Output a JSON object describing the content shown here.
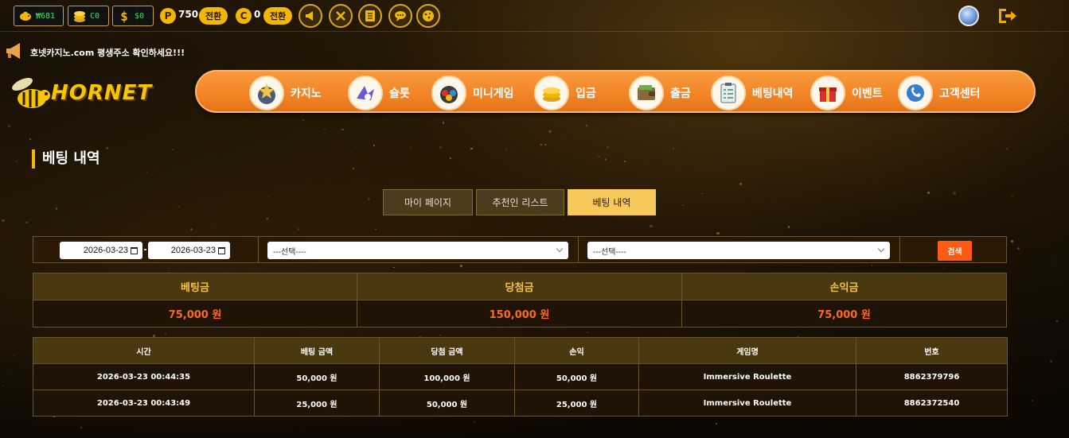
{
  "topbar": {
    "wallets": [
      {
        "icon": "piggy-bank-icon",
        "value": "₩681"
      },
      {
        "icon": "coin-stack-icon",
        "value": "C0"
      },
      {
        "icon": "dollar-icon",
        "value": "$0"
      }
    ],
    "point": {
      "badge": "P",
      "value": "750",
      "swap_label": "전환"
    },
    "coin": {
      "badge": "C",
      "value": "0",
      "swap_label": "전환"
    },
    "icons": [
      "megaphone-icon",
      "tools-icon",
      "notepad-icon",
      "chat-icon",
      "cookie-icon"
    ]
  },
  "notice": {
    "text": "호넷카지노.com 평생주소 확인하세요!!!"
  },
  "logo": {
    "text": "HORNET"
  },
  "nav": [
    {
      "label": "카지노",
      "icon": "casino-chip-icon"
    },
    {
      "label": "슬롯",
      "icon": "slot-icon"
    },
    {
      "label": "미니게임",
      "icon": "minigame-icon"
    },
    {
      "label": "입금",
      "icon": "deposit-coins-icon"
    },
    {
      "label": "출금",
      "icon": "wallet-icon"
    },
    {
      "label": "베팅내역",
      "icon": "clipboard-icon"
    },
    {
      "label": "이벤트",
      "icon": "gift-icon"
    },
    {
      "label": "고객센터",
      "icon": "support-chat-icon"
    }
  ],
  "page": {
    "title": "베팅 내역"
  },
  "tabs": [
    {
      "label": "마이 페이지",
      "active": false
    },
    {
      "label": "추천인 리스트",
      "active": false
    },
    {
      "label": "베팅 내역",
      "active": true
    }
  ],
  "filter": {
    "date_from": "2026-03-23",
    "date_to": "2026-03-23",
    "select1": "---선택----",
    "select2": "---선택----",
    "search_label": "검색"
  },
  "summary": [
    {
      "label": "베팅금",
      "value": "75,000 원"
    },
    {
      "label": "당첨금",
      "value": "150,000 원"
    },
    {
      "label": "손익금",
      "value": "75,000 원"
    }
  ],
  "table": {
    "headers": [
      "시간",
      "베팅 금액",
      "당첨 금액",
      "손익",
      "게임명",
      "번호"
    ],
    "rows": [
      [
        "2026-03-23 00:44:35",
        "50,000 원",
        "100,000 원",
        "50,000 원",
        "Immersive Roulette",
        "8862379796"
      ],
      [
        "2026-03-23 00:43:49",
        "25,000 원",
        "50,000 원",
        "25,000 원",
        "Immersive Roulette",
        "8862372540"
      ]
    ]
  }
}
